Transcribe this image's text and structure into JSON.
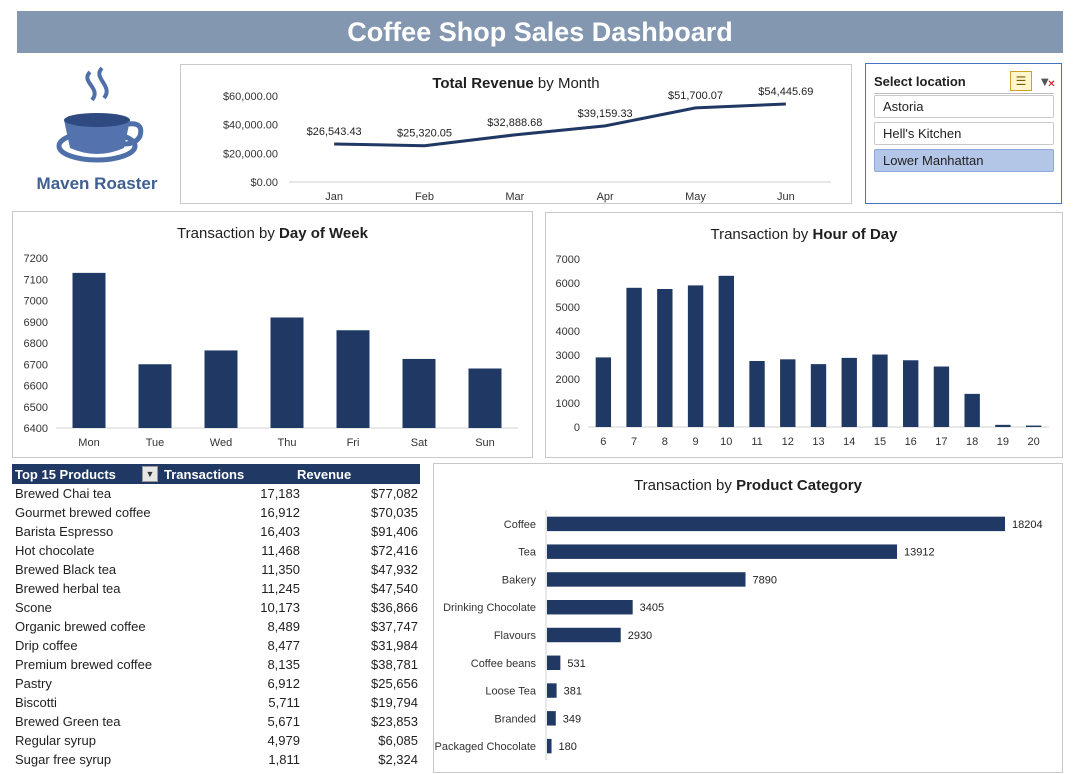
{
  "dashboard": {
    "title": "Coffee Shop Sales Dashboard",
    "brand": "Maven Roaster"
  },
  "colors": {
    "bar": "#1f3864",
    "line": "#203864",
    "header": "#8497b0",
    "selected": "#b4c6e7"
  },
  "slicer": {
    "title": "Select location",
    "items": [
      "Astoria",
      "Hell's Kitchen",
      "Lower Manhattan"
    ],
    "selected": "Lower Manhattan"
  },
  "table": {
    "headers": [
      "Top 15 Products",
      "Transactions",
      "Revenue"
    ],
    "rows": [
      [
        "Brewed Chai tea",
        "17,183",
        "$77,082"
      ],
      [
        "Gourmet brewed coffee",
        "16,912",
        "$70,035"
      ],
      [
        "Barista Espresso",
        "16,403",
        "$91,406"
      ],
      [
        "Hot chocolate",
        "11,468",
        "$72,416"
      ],
      [
        "Brewed Black tea",
        "11,350",
        "$47,932"
      ],
      [
        "Brewed herbal tea",
        "11,245",
        "$47,540"
      ],
      [
        "Scone",
        "10,173",
        "$36,866"
      ],
      [
        "Organic brewed coffee",
        "8,489",
        "$37,747"
      ],
      [
        "Drip coffee",
        "8,477",
        "$31,984"
      ],
      [
        "Premium brewed coffee",
        "8,135",
        "$38,781"
      ],
      [
        "Pastry",
        "6,912",
        "$25,656"
      ],
      [
        "Biscotti",
        "5,711",
        "$19,794"
      ],
      [
        "Brewed Green tea",
        "5,671",
        "$23,853"
      ],
      [
        "Regular syrup",
        "4,979",
        "$6,085"
      ],
      [
        "Sugar free syrup",
        "1,811",
        "$2,324"
      ]
    ]
  },
  "chart_data": [
    {
      "type": "line",
      "title_bold": "Total Revenue",
      "title_rest": " by Month",
      "categories": [
        "Jan",
        "Feb",
        "Mar",
        "Apr",
        "May",
        "Jun"
      ],
      "values": [
        26543.43,
        25320.05,
        32888.68,
        39159.33,
        51700.07,
        54445.69
      ],
      "data_labels": [
        "$26,543.43",
        "$25,320.05",
        "$32,888.68",
        "$39,159.33",
        "$51,700.07",
        "$54,445.69"
      ],
      "y_ticks": [
        "$0.00",
        "$20,000.00",
        "$40,000.00",
        "$60,000.00"
      ],
      "ylim": [
        0,
        60000
      ]
    },
    {
      "type": "bar",
      "title_rest": "Transaction by ",
      "title_bold": "Day of Week",
      "categories": [
        "Mon",
        "Tue",
        "Wed",
        "Thu",
        "Fri",
        "Sat",
        "Sun"
      ],
      "values": [
        7130,
        6700,
        6765,
        6920,
        6860,
        6725,
        6680
      ],
      "y_ticks": [
        "6400",
        "6500",
        "6600",
        "6700",
        "6800",
        "6900",
        "7000",
        "7100",
        "7200"
      ],
      "ylim": [
        6400,
        7200
      ]
    },
    {
      "type": "bar",
      "title_rest": "Transaction by ",
      "title_bold": "Hour of Day",
      "categories": [
        "6",
        "7",
        "8",
        "9",
        "10",
        "11",
        "12",
        "13",
        "14",
        "15",
        "16",
        "17",
        "18",
        "19",
        "20"
      ],
      "values": [
        2900,
        5800,
        5750,
        5900,
        6300,
        2750,
        2820,
        2620,
        2880,
        3020,
        2780,
        2520,
        1380,
        90,
        60
      ],
      "y_ticks": [
        "0",
        "1000",
        "2000",
        "3000",
        "4000",
        "5000",
        "6000",
        "7000"
      ],
      "ylim": [
        0,
        7000
      ]
    },
    {
      "type": "bar",
      "orientation": "horizontal",
      "title_rest": "Transaction by ",
      "title_bold": "Product Category",
      "categories": [
        "Coffee",
        "Tea",
        "Bakery",
        "Drinking Chocolate",
        "Flavours",
        "Coffee beans",
        "Loose Tea",
        "Branded",
        "Packaged Chocolate"
      ],
      "values": [
        18204,
        13912,
        7890,
        3405,
        2930,
        531,
        381,
        349,
        180
      ],
      "xlim": [
        0,
        18204
      ]
    }
  ]
}
